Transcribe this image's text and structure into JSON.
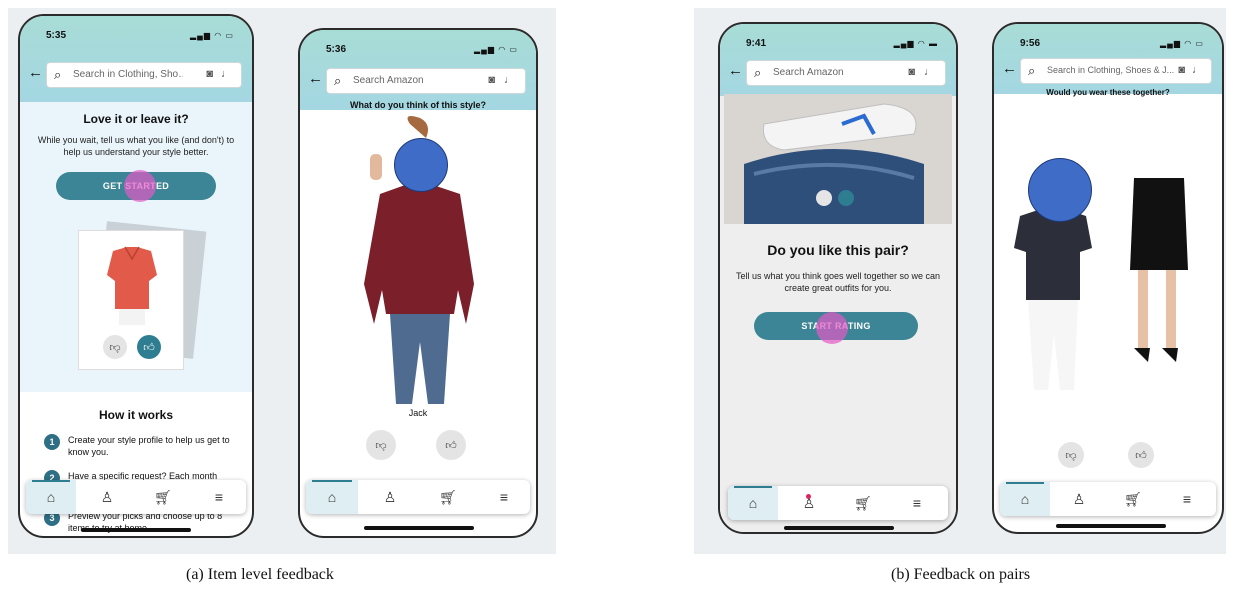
{
  "captions": {
    "a": "(a) Item level feedback",
    "b": "(b) Feedback on pairs"
  },
  "icons": {
    "back": "back-arrow-icon",
    "search": "search-icon",
    "camera": "camera-icon",
    "mic": "mic-icon",
    "home": "home-icon",
    "profile": "profile-icon",
    "cart": "cart-icon",
    "menu": "menu-icon",
    "thumbs_up": "thumbs-up-icon",
    "thumbs_down": "thumbs-down-icon"
  },
  "colors": {
    "accent": "#3b8596",
    "tap_indicator": "#e35ac4",
    "face_blur": "#3f6cc7"
  },
  "phones": [
    {
      "time": "5:35",
      "search_placeholder": "Search in Clothing, Sho…",
      "title": "Love it or leave it?",
      "subtitle": "While you wait, tell us what you like (and don't) to help us understand your style better.",
      "cta": "GET STARTED",
      "how_title": "How it works",
      "steps": [
        {
          "num": "1",
          "text": "Create your style profile to help us get to know you."
        },
        {
          "num": "2",
          "text": "Have a specific request? Each month"
        },
        {
          "num": "3",
          "text": "Preview your picks and choose up to 8 items to try at home."
        }
      ]
    },
    {
      "time": "5:36",
      "search_placeholder": "Search Amazon",
      "question": "What do you think of this style?",
      "brand": "Jack"
    },
    {
      "time": "9:41",
      "search_placeholder": "Search Amazon",
      "title": "Do you like this pair?",
      "subtitle": "Tell us what you think goes well together so we can create great outfits for you.",
      "cta": "START RATING"
    },
    {
      "time": "9:56",
      "search_placeholder": "Search in Clothing, Shoes & J...",
      "question": "Would you wear these together?"
    }
  ]
}
